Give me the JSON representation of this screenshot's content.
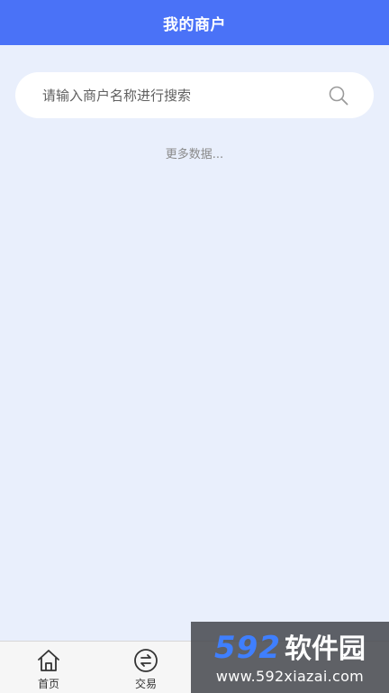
{
  "header": {
    "title": "我的商户"
  },
  "search": {
    "placeholder": "请输入商户名称进行搜索",
    "value": ""
  },
  "list": {
    "more_text": "更多数据..."
  },
  "tabbar": {
    "items": [
      {
        "label": "首页",
        "icon": "home-icon"
      },
      {
        "label": "交易",
        "icon": "exchange-icon"
      },
      {
        "label": "",
        "icon": "hidden-tab-icon"
      },
      {
        "label": "",
        "icon": "hidden-tab-icon"
      }
    ]
  },
  "watermark": {
    "brand_number": "592",
    "brand_text": "软件园",
    "url": "www.592xiazai.com"
  },
  "colors": {
    "header": "#4a72f7",
    "background": "#e9effc",
    "search_bg": "#ffffff"
  }
}
